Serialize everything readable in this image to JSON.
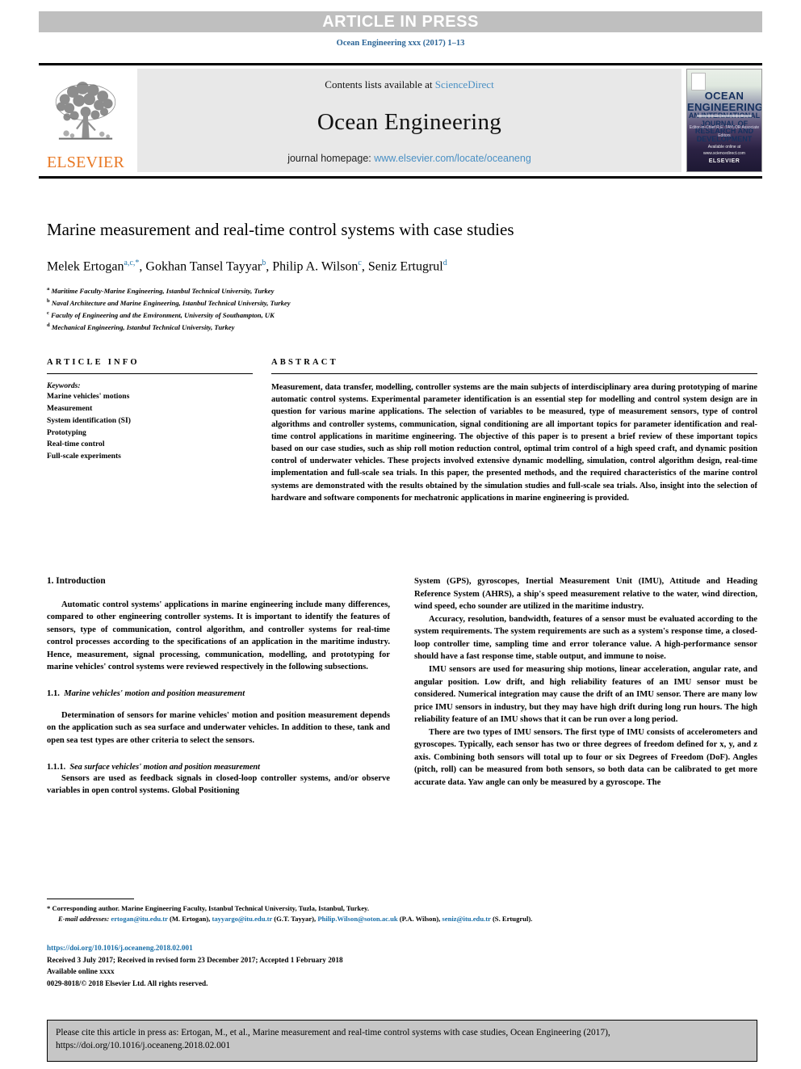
{
  "banner": {
    "article_in_press": "ARTICLE IN PRESS",
    "journal_ref": "Ocean Engineering xxx (2017) 1–13"
  },
  "masthead": {
    "contents_prefix": "Contents lists available at ",
    "sciencedirect": "ScienceDirect",
    "journal_title": "Ocean Engineering",
    "homepage_prefix": "journal homepage: ",
    "homepage_url": "www.elsevier.com/locate/oceaneng",
    "publisher_wordmark": "ELSEVIER",
    "cover": {
      "title_line1": "OCEAN",
      "title_line2": "ENGINEERING",
      "subtitle": "AN INTERNATIONAL JOURNAL OF RESEARCH AND DEVELOPMENT",
      "editors": "Editor-in-Chief\nR.E. TAYLOR\nAssociate Editors",
      "publisher": "ELSEVIER",
      "footer_note": "Available online at www.sciencedirect.com"
    }
  },
  "article": {
    "title": "Marine measurement and real-time control systems with case studies",
    "authors": [
      {
        "name": "Melek Ertogan",
        "marks": "a,c,*"
      },
      {
        "name": "Gokhan Tansel Tayyar",
        "marks": "b"
      },
      {
        "name": "Philip A. Wilson",
        "marks": "c"
      },
      {
        "name": "Seniz Ertugrul",
        "marks": "d"
      }
    ],
    "affiliations": [
      {
        "mark": "a",
        "text": "Maritime Faculty-Marine Engineering, Istanbul Technical University, Turkey"
      },
      {
        "mark": "b",
        "text": "Naval Architecture and Marine Engineering, Istanbul Technical University, Turkey"
      },
      {
        "mark": "c",
        "text": "Faculty of Engineering and the Environment, University of Southampton, UK"
      },
      {
        "mark": "d",
        "text": "Mechanical Engineering, Istanbul Technical University, Turkey"
      }
    ]
  },
  "info": {
    "heading": "ARTICLE INFO",
    "keywords_label": "Keywords:",
    "keywords": [
      "Marine vehicles' motions",
      "Measurement",
      "System identification (SI)",
      "Prototyping",
      "Real-time control",
      "Full-scale experiments"
    ]
  },
  "abstract": {
    "heading": "ABSTRACT",
    "body": "Measurement, data transfer, modelling, controller systems are the main subjects of interdisciplinary area during prototyping of marine automatic control systems. Experimental parameter identification is an essential step for modelling and control system design are in question for various marine applications. The selection of variables to be measured, type of measurement sensors, type of control algorithms and controller systems, communication, signal conditioning are all important topics for parameter identification and real-time control applications in maritime engineering. The objective of this paper is to present a brief review of these important topics based on our case studies, such as ship roll motion reduction control, optimal trim control of a high speed craft, and dynamic position control of underwater vehicles. These projects involved extensive dynamic modelling, simulation, control algorithm design, real-time implementation and full-scale sea trials. In this paper, the presented methods, and the required characteristics of the marine control systems are demonstrated with the results obtained by the simulation studies and full-scale sea trials. Also, insight into the selection of hardware and software components for mechatronic applications in marine engineering is provided."
  },
  "body": {
    "left": {
      "section_heading": "1.  Introduction",
      "para1": "Automatic control systems' applications in marine engineering include many differences, compared to other engineering controller systems. It is important to identify the features of sensors, type of communication, control algorithm, and controller systems for real-time control processes according to the specifications of an application in the maritime industry. Hence, measurement, signal processing, communication, modelling, and prototyping for marine vehicles' control systems were reviewed respectively in the following subsections.",
      "subsec1_num": "1.1.",
      "subsec1_title": "Marine vehicles' motion and position measurement",
      "para2": "Determination of sensors for marine vehicles' motion and position measurement depends on the application such as sea surface and underwater vehicles. In addition to these, tank and open sea test types are other criteria to select the sensors.",
      "subsec2_num": "1.1.1.",
      "subsec2_title": "Sea surface vehicles' motion and position measurement",
      "para3": "Sensors are used as feedback signals in closed-loop controller systems, and/or observe variables in open control systems. Global Positioning"
    },
    "right": {
      "para1": "System (GPS), gyroscopes, Inertial Measurement Unit (IMU), Attitude and Heading Reference System (AHRS), a ship's speed measurement relative to the water, wind direction, wind speed, echo sounder are utilized in the maritime industry.",
      "para2": "Accuracy, resolution, bandwidth, features of a sensor must be evaluated according to the system requirements. The system requirements are such as a system's response time, a closed-loop controller time, sampling time and error tolerance value. A high-performance sensor should have a fast response time, stable output, and immune to noise.",
      "para3": "IMU sensors are used for measuring ship motions, linear acceleration, angular rate, and angular position. Low drift, and high reliability features of an IMU sensor must be considered. Numerical integration may cause the drift of an IMU sensor. There are many low price IMU sensors in industry, but they may have high drift during long run hours. The high reliability feature of an IMU shows that it can be run over a long period.",
      "para4": "There are two types of IMU sensors. The first type of IMU consists of accelerometers and gyroscopes. Typically, each sensor has two or three degrees of freedom defined for x, y, and z axis. Combining both sensors will total up to four or six Degrees of Freedom (DoF). Angles (pitch, roll) can be measured from both sensors, so both data can be calibrated to get more accurate data. Yaw angle can only be measured by a gyroscope. The"
    }
  },
  "footnotes": {
    "corresponding": "* Corresponding author. Marine Engineering Faculty, Istanbul Technical University, Tuzla, Istanbul, Turkey.",
    "email_label": "E-mail addresses:",
    "emails": [
      {
        "address": "ertogan@itu.edu.tr",
        "owner": "(M. Ertogan),"
      },
      {
        "address": "tayyargo@itu.edu.tr",
        "owner": "(G.T. Tayyar),"
      },
      {
        "address": "Philip.Wilson@soton.ac.uk",
        "owner": "(P.A. Wilson),"
      },
      {
        "address": "seniz@itu.edu.tr",
        "owner": "(S. Ertugrul)."
      }
    ]
  },
  "pubinfo": {
    "doi": "https://doi.org/10.1016/j.oceaneng.2018.02.001",
    "dates": "Received 3 July 2017; Received in revised form 23 December 2017; Accepted 1 February 2018",
    "available": "Available online xxxx",
    "copyright": "0029-8018/© 2018 Elsevier Ltd. All rights reserved."
  },
  "cite_box": {
    "line1": "Please cite this article in press as: Ertogan, M., et al., Marine measurement and real-time control systems with case studies, Ocean Engineering (2017),",
    "line2": "https://doi.org/10.1016/j.oceaneng.2018.02.001"
  },
  "colors": {
    "link": "#1a6fa8",
    "banner_bg": "#bfbfbf",
    "masthead_bg": "#e8e8e8",
    "elsevier_orange": "#E87722",
    "cite_bg": "#c6c6c6"
  }
}
